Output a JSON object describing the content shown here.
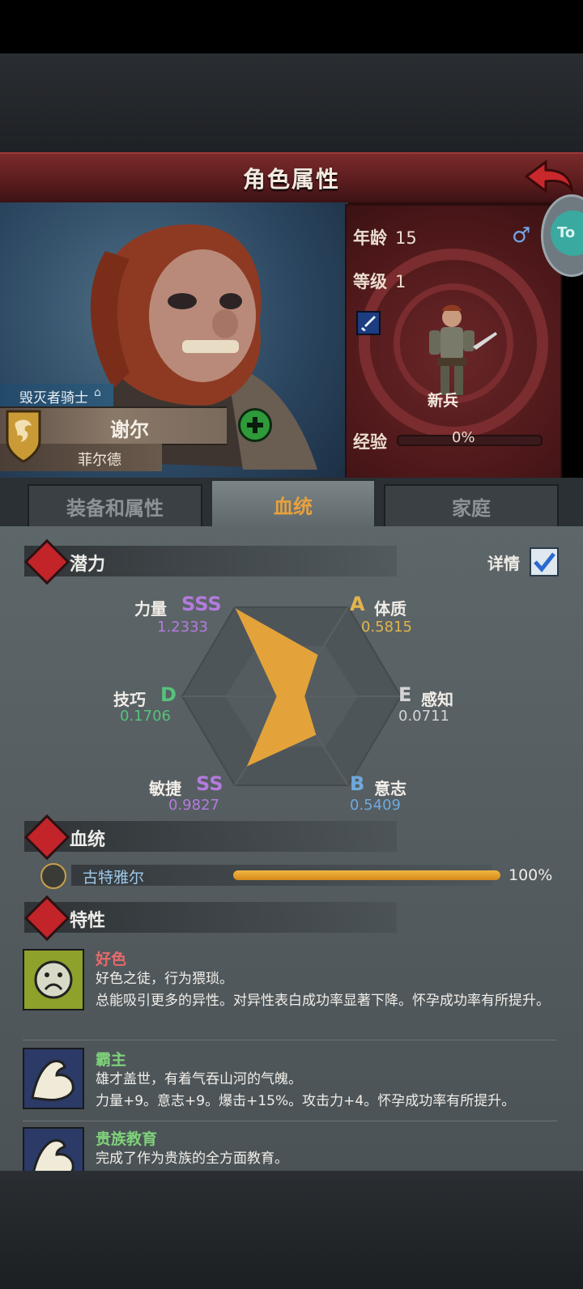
{
  "header": {
    "title": "角色属性"
  },
  "character": {
    "title_rank": "毁灭者骑士",
    "name": "谢尔",
    "house": "菲尔德",
    "age_label": "年龄",
    "age": "15",
    "level_label": "等级",
    "level": "1",
    "class_name": "新兵",
    "exp_label": "经验",
    "exp_percent": "0%",
    "gender_icon": "male-icon"
  },
  "side_tab_label": "To",
  "tabs": [
    {
      "label": "装备和属性",
      "active": false
    },
    {
      "label": "血统",
      "active": true
    },
    {
      "label": "家庭",
      "active": false
    }
  ],
  "potential": {
    "title": "潜力",
    "details_label": "详情",
    "details_checked": true,
    "stats": [
      {
        "name": "力量",
        "grade": "SSS",
        "value": "1.2333",
        "color": "#b47bde"
      },
      {
        "name": "体质",
        "grade": "A",
        "value": "0.5815",
        "color": "#e3b44c"
      },
      {
        "name": "感知",
        "grade": "E",
        "value": "0.0711",
        "color": "#d4d4d4"
      },
      {
        "name": "意志",
        "grade": "B",
        "value": "0.5409",
        "color": "#6fa9dd"
      },
      {
        "name": "敏捷",
        "grade": "SS",
        "value": "0.9827",
        "color": "#b47bde"
      },
      {
        "name": "技巧",
        "grade": "D",
        "value": "0.1706",
        "color": "#56c27a"
      }
    ],
    "radar_fill": "#e3a33a"
  },
  "bloodline": {
    "title": "血统",
    "entries": [
      {
        "name": "古特雅尔",
        "percent": "100%",
        "fraction": 1.0
      }
    ]
  },
  "traits": {
    "title": "特性",
    "items": [
      {
        "name": "好色",
        "name_color": "#e66a6a",
        "line1": "好色之徒，行为猥琐。",
        "line2": "总能吸引更多的异性。对异性表白成功率显著下降。怀孕成功率有所提升。"
      },
      {
        "name": "霸主",
        "name_color": "#7fd27a",
        "line1": "雄才盖世，有着气吞山河的气魄。",
        "line2": "力量+9。意志+9。爆击+15%。攻击力+4。怀孕成功率有所提升。"
      },
      {
        "name": "贵族教育",
        "name_color": "#7fd27a",
        "line1": "完成了作为贵族的全方面教育。",
        "line2": ""
      }
    ]
  }
}
